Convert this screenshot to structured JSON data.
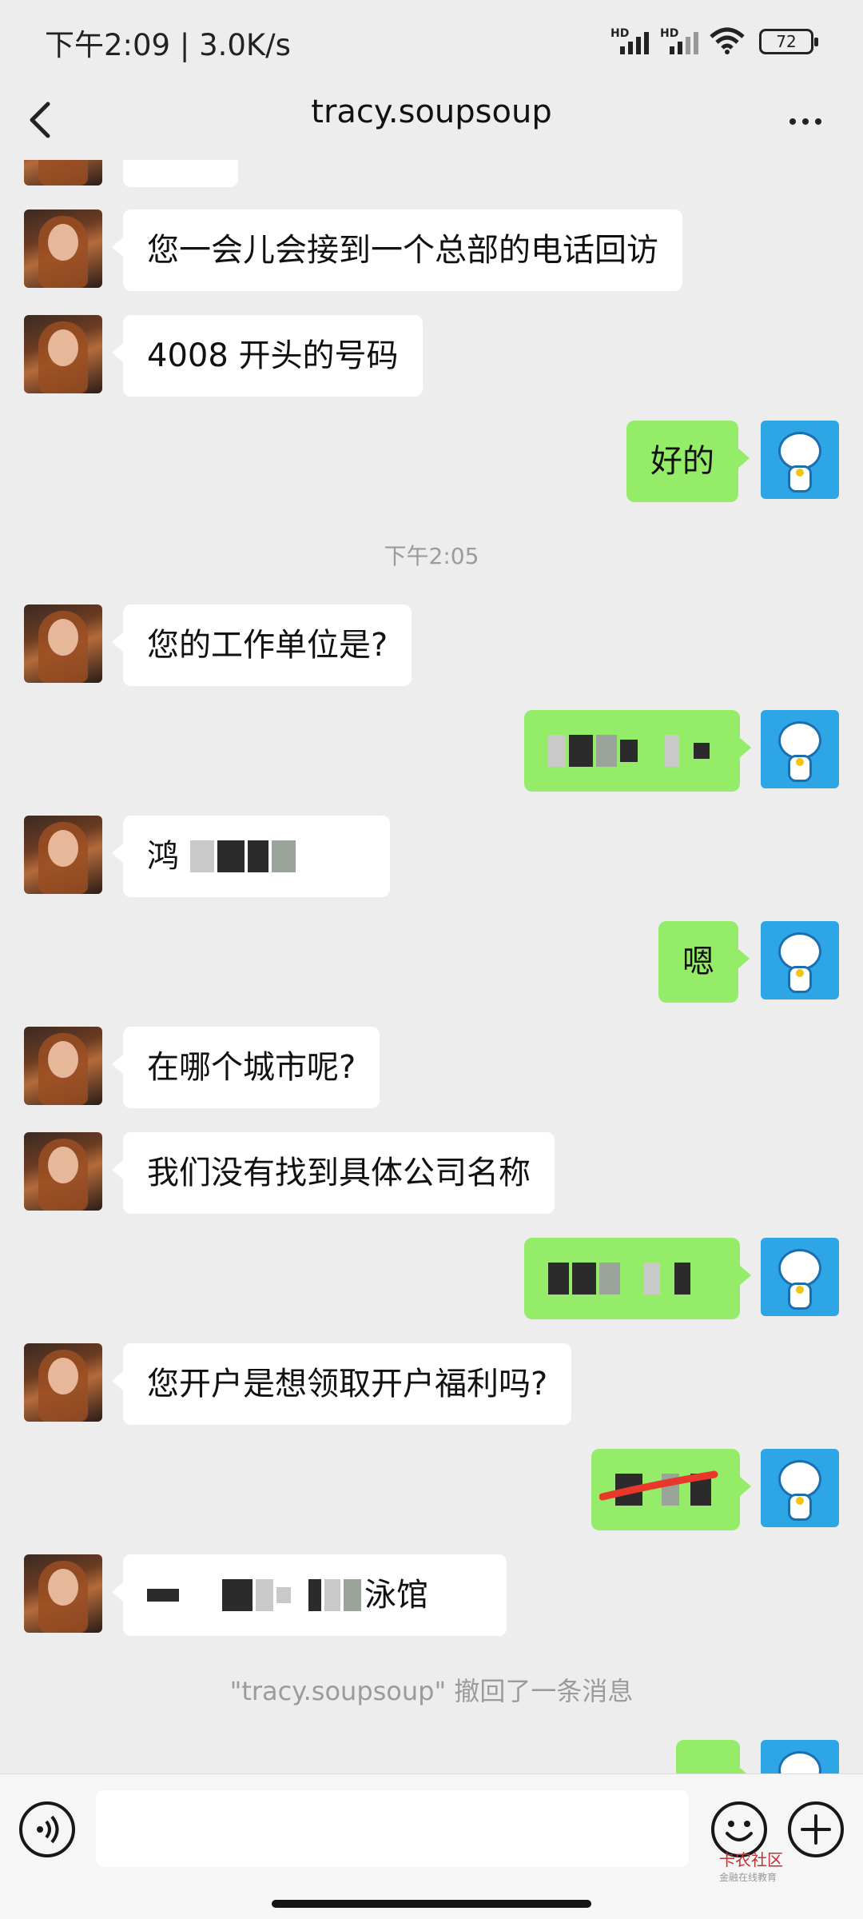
{
  "status_bar": {
    "time": "下午2:09 | 3.0K/s",
    "hd1": "HD",
    "hd2": "HD",
    "battery": "72"
  },
  "header": {
    "title": "tracy.soupsoup"
  },
  "messages": {
    "m1": "您一会儿会接到一个总部的电话回访",
    "m2": "4008 开头的号码",
    "m3": "好的",
    "timestamp": "下午2:05",
    "m4": "您的工作单位是?",
    "m6_visible": "鸿",
    "m7": "嗯",
    "m8": "在哪个城市呢?",
    "m9": "我们没有找到具体公司名称",
    "m11": "您开户是想领取开户福利吗?",
    "m13_tail": "泳馆",
    "recall_notice": "\"tracy.soupsoup\" 撤回了一条消息"
  },
  "watermark": {
    "text": "卡农社区",
    "sub": "金融在线教育"
  },
  "colors": {
    "bg": "#ededed",
    "incoming": "#ffffff",
    "outgoing": "#95ec69"
  },
  "icons": [
    "back-arrow-icon",
    "more-dots-icon",
    "voice-icon",
    "emoji-icon",
    "plus-icon"
  ]
}
